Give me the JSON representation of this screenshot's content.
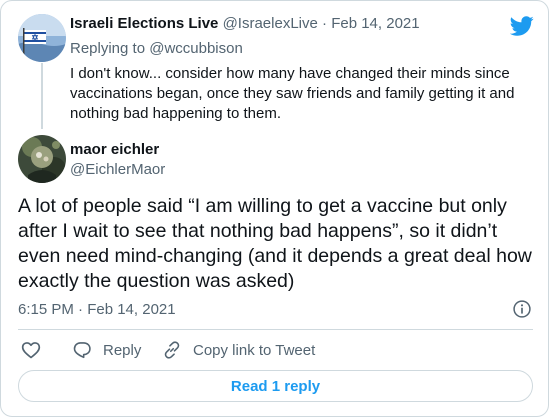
{
  "parent_tweet": {
    "display_name": "Israeli Elections Live",
    "handle": "@IsraelexLive",
    "separator": "·",
    "date": "Feb 14, 2021",
    "replying_label": "Replying to",
    "replying_handle": "@wccubbison",
    "text": "I don't know... consider how many have changed their minds since vaccinations began, once they saw friends and family getting it and nothing bad happening to them."
  },
  "main_tweet": {
    "display_name": "maor eichler",
    "handle": "@EichlerMaor",
    "text": "A lot of people said “I am willing to get a vaccine but only after I wait to see that nothing bad happens”, so it didn’t even need mind-changing (and it depends a great deal how exactly the question was asked)",
    "timestamp": "6:15 PM · Feb 14, 2021"
  },
  "actions": {
    "reply_label": "Reply",
    "copy_link_label": "Copy link to Tweet"
  },
  "read_replies_label": "Read 1 reply",
  "icons": {
    "brand": "twitter-bird-icon",
    "info": "info-icon",
    "like": "heart-icon",
    "reply": "speech-bubble-icon",
    "copy": "link-icon"
  },
  "colors": {
    "accent": "#1d9bf0",
    "muted_text": "#536471",
    "border": "#cfd9de",
    "text": "#0f1419"
  }
}
